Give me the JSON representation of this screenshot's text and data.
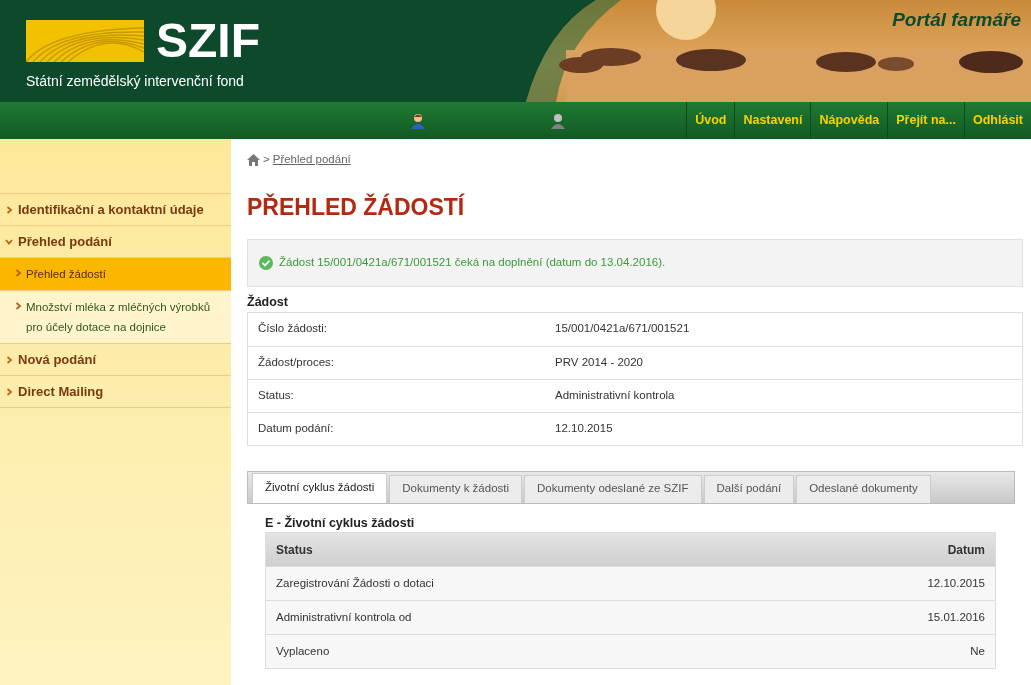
{
  "header": {
    "logo_text": "SZIF",
    "subtitle": "Státní zemědělský intervenční fond",
    "portal": "Portál farmáře"
  },
  "nav": {
    "items": [
      "Úvod",
      "Nastavení",
      "Nápověda",
      "Přejít na...",
      "Odhlásit"
    ]
  },
  "sidebar": {
    "items": [
      {
        "label": "Identifikační a kontaktní údaje",
        "expanded": false,
        "selected": false
      },
      {
        "label": "Přehled podání",
        "expanded": true,
        "selected": false,
        "children": [
          {
            "label": "Přehled žádostí",
            "selected": true
          },
          {
            "label": "Množství mléka z mléčných výrobků pro účely dotace na dojnice",
            "selected": false
          }
        ]
      },
      {
        "label": "Nová podání",
        "expanded": false,
        "selected": false
      },
      {
        "label": "Direct Mailing",
        "expanded": false,
        "selected": false
      }
    ]
  },
  "breadcrumb": {
    "separator": ">",
    "link": "Přehled podání"
  },
  "page_title": "PŘEHLED ŽÁDOSTÍ",
  "message": "Žádost 15/001/0421a/671/001521 čeká na doplnění (datum do 13.04.2016).",
  "details": {
    "title": "Žádost",
    "rows": [
      {
        "label": "Číslo žádosti:",
        "value": "15/001/0421a/671/001521"
      },
      {
        "label": "Žádost/proces:",
        "value": "PRV 2014 - 2020"
      },
      {
        "label": "Status:",
        "value": "Administrativní kontrola"
      },
      {
        "label": "Datum podání:",
        "value": "12.10.2015"
      }
    ]
  },
  "tabs": [
    {
      "label": "Životní cyklus žádosti",
      "selected": true
    },
    {
      "label": "Dokumenty k žádosti",
      "selected": false
    },
    {
      "label": "Dokumenty odeslané ze SZIF",
      "selected": false
    },
    {
      "label": "Další podání",
      "selected": false
    },
    {
      "label": "Odeslané dokumenty",
      "selected": false
    }
  ],
  "lifecycle": {
    "title": "E - Životní cyklus žádosti",
    "columns": [
      "Status",
      "Datum"
    ],
    "rows": [
      [
        "Zaregistrování Žádosti o dotaci",
        "12.10.2015"
      ],
      [
        "Administrativní kontrola od",
        "15.01.2016"
      ],
      [
        "Vyplaceno",
        "Ne"
      ]
    ]
  }
}
